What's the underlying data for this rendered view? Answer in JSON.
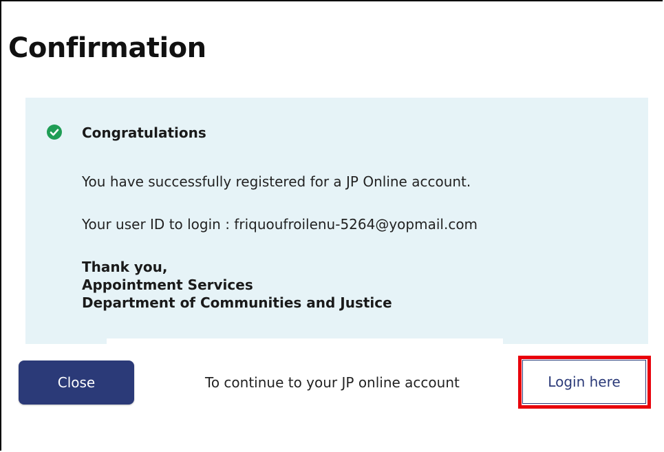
{
  "dialog": {
    "title": "Confirmation"
  },
  "message": {
    "heading": "Congratulations",
    "icon": "check-circle-icon",
    "success_color": "#1f9d55",
    "registered_text": "You have successfully registered for a JP Online account.",
    "user_id_text": "Your user ID to login : friquoufroilenu-5264@yopmail.com",
    "signoff": {
      "thanks": "Thank you,",
      "team": "Appointment Services",
      "department": "Department of Communities and Justice"
    },
    "panel_color": "#e6f3f7"
  },
  "actions": {
    "close_label": "Close",
    "continue_text": "To continue to your JP online account",
    "login_label": "Login here",
    "primary_color": "#2b3a78",
    "highlight_color": "#e8000b"
  }
}
